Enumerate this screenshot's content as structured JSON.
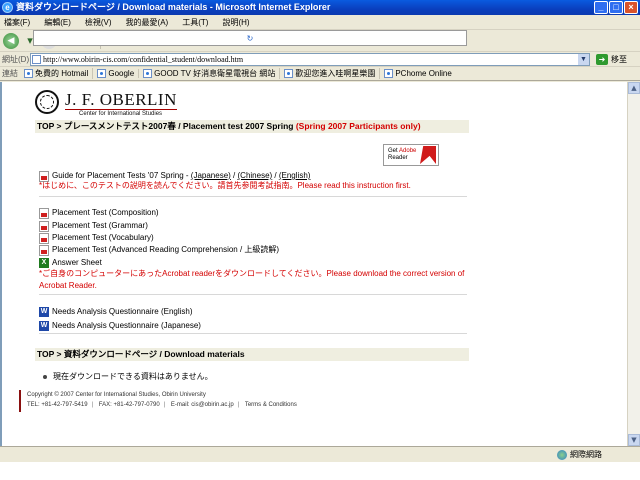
{
  "window": {
    "title": "資料ダウンロードページ / Download materials - Microsoft Internet Explorer"
  },
  "menu": [
    "檔案(F)",
    "編輯(E)",
    "檢視(V)",
    "我的最愛(A)",
    "工具(T)",
    "說明(H)"
  ],
  "address": {
    "label": "網址(D)",
    "url": "http://www.obirin-cis.com/confidential_student/download.htm",
    "go_label": "移至"
  },
  "links": {
    "label": "連結",
    "items": [
      "免費的 Hotmail",
      "Google",
      "GOOD TV 好消息衛星電視台 網站",
      "歡迎您進入哇啊星樂園",
      "PChome Online"
    ]
  },
  "page": {
    "logo": {
      "name": "J. F. OBERLIN",
      "subtitle": "Center for International Studies"
    },
    "section1": {
      "header": "TOP > プレースメントテスト2007春 / Placement test 2007 Spring",
      "header_red": "(Spring 2007 Participants only)"
    },
    "adobe": {
      "line1": "Get",
      "line2": "Adobe",
      "line3": "Reader"
    },
    "guide": {
      "label": "Guide for Placement Tests '07 Spring  -",
      "links": [
        "(Japanese)",
        "(Chinese)",
        "(English)"
      ],
      "note": "*はじめに、このテストの説明を読んでください。請首先参閱考試指南。Please read this instruction first."
    },
    "tests": [
      "Placement Test (Composition)",
      "Placement Test (Grammar)",
      "Placement Test (Vocabulary)",
      "Placement Test (Advanced Reading Comprehension / 上級読解)"
    ],
    "answer_sheet": "Answer Sheet",
    "acrobat_note": "*ご自身のコンピューターにあったAcrobat readerをダウンロードしてください。Please download the correct version of Acrobat Reader.",
    "questionnaires": [
      "Needs Analysis Questionnaire (English)",
      "Needs Analysis Questionnaire (Japanese)"
    ],
    "section2": {
      "header": "TOP > 資料ダウンロードページ / Download materials",
      "bullet": "現在ダウンロードできる資料はありません。"
    },
    "footer": {
      "copyright": "Copyright © 2007 Center for International Studies, Obirin University",
      "tel": "TEL: +81-42-797-5419",
      "fax": "FAX: +81-42-797-0790",
      "email": "E-mail: cis@obirin.ac.jp",
      "terms": "Terms & Conditions"
    }
  },
  "status": {
    "zone": "網際網路"
  }
}
